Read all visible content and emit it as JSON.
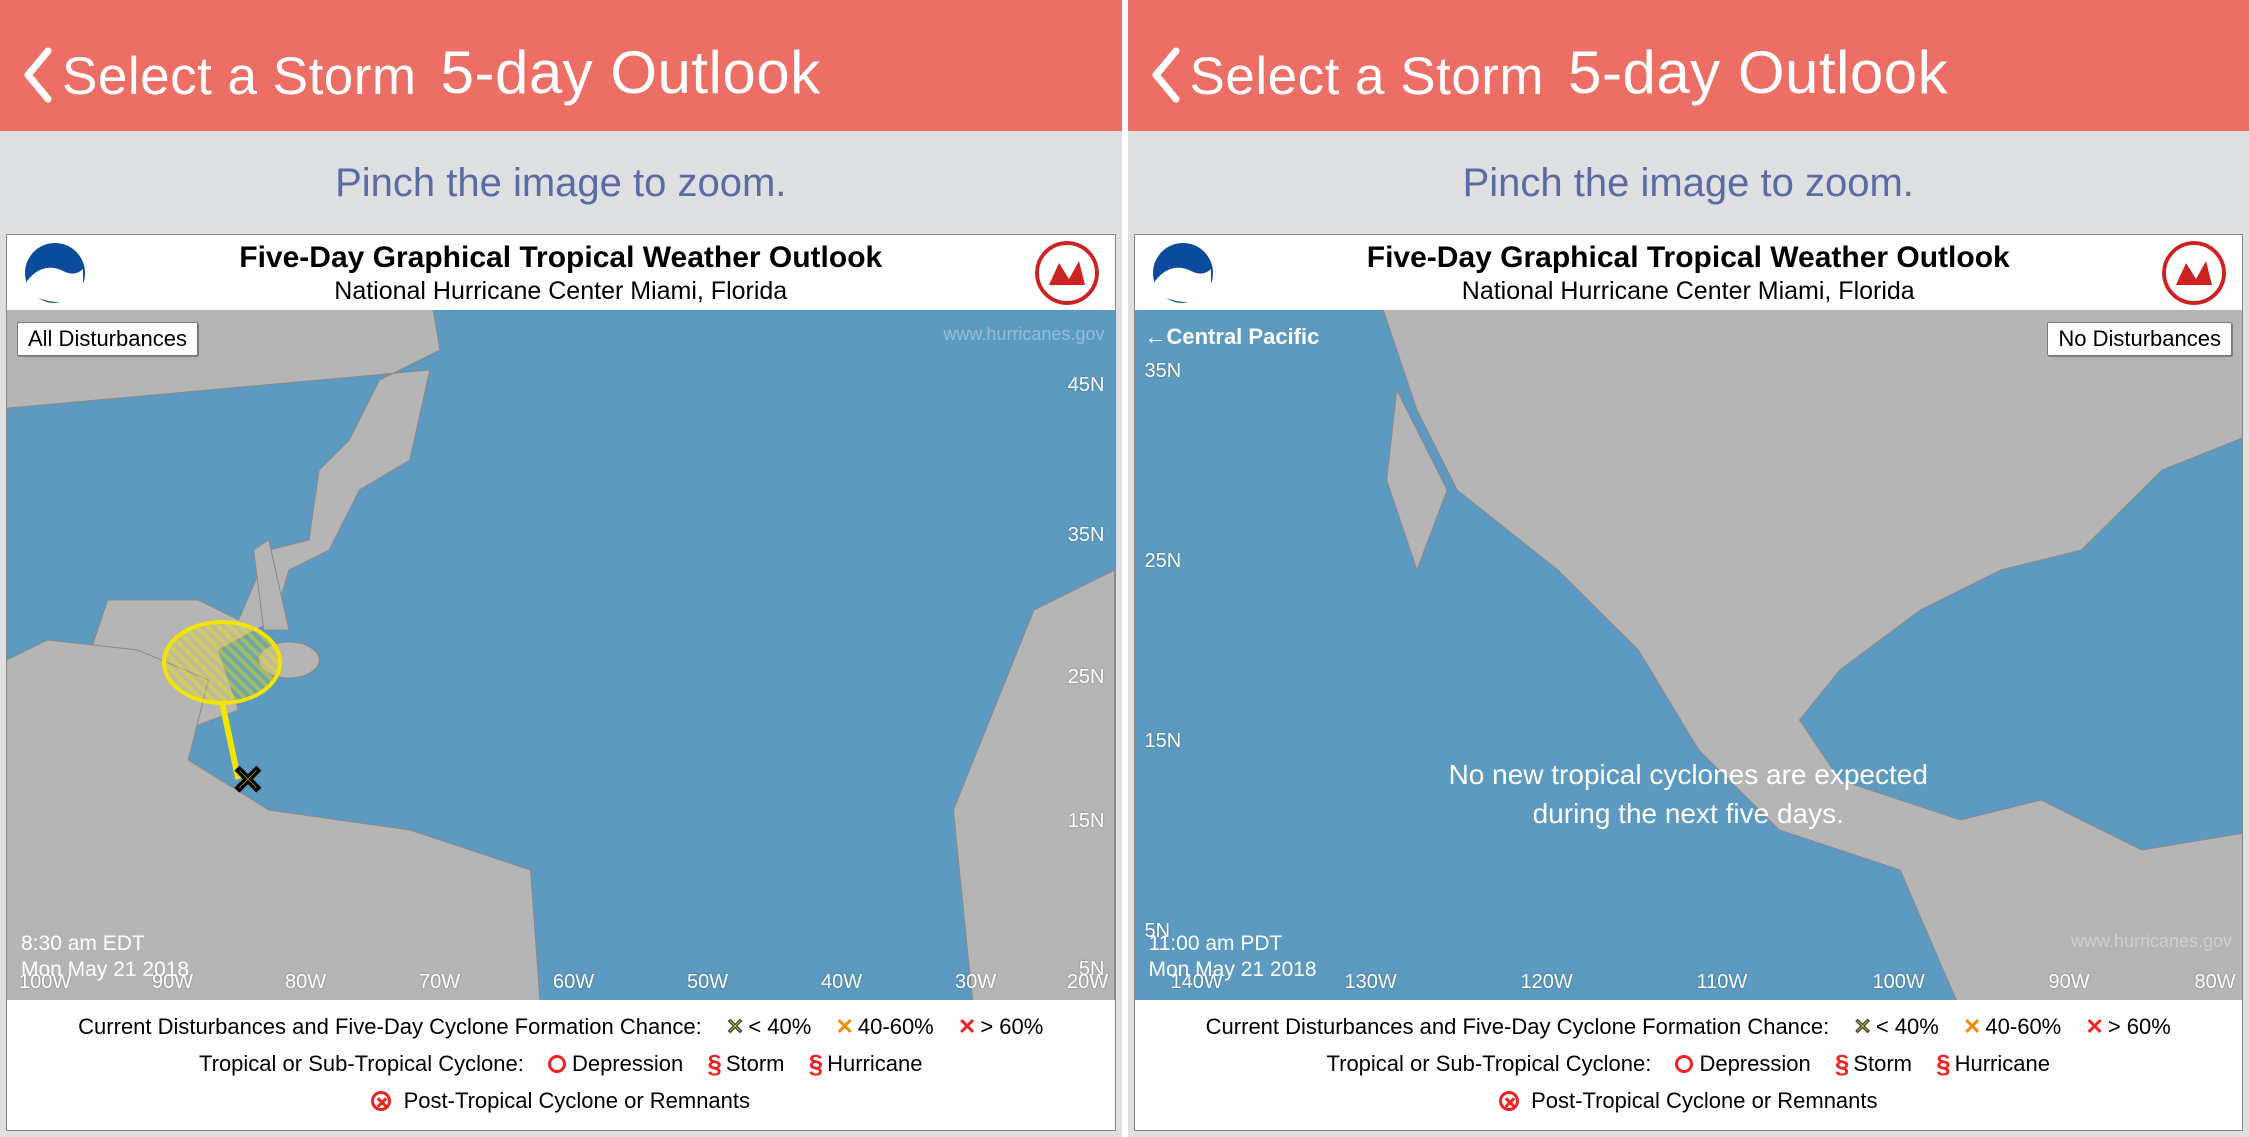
{
  "common": {
    "back_label": "Select a Storm",
    "title": "5-day Outlook",
    "hint": "Pinch the image to zoom.",
    "map_title": "Five-Day Graphical Tropical Weather Outlook",
    "map_subtitle": "National Hurricane Center  Miami, Florida",
    "watermark": "www.hurricanes.gov",
    "legend_line1_label": "Current Disturbances and Five-Day Cyclone Formation Chance:",
    "legend_lt40": "< 40%",
    "legend_4060": "40-60%",
    "legend_gt60": "> 60%",
    "legend_line2_label": "Tropical or Sub-Tropical Cyclone:",
    "legend_depression": "Depression",
    "legend_storm": "Storm",
    "legend_hurricane": "Hurricane",
    "legend_line3": "Post-Tropical Cyclone or Remnants"
  },
  "left": {
    "pill": "All Disturbances",
    "timestamp_line1": "8:30 am EDT",
    "timestamp_line2": "Mon May 21 2018",
    "lats": [
      "45N",
      "35N",
      "25N",
      "15N",
      "5N"
    ],
    "lons": [
      "100W",
      "90W",
      "80W",
      "70W",
      "60W",
      "50W",
      "40W",
      "30W",
      "20W"
    ]
  },
  "right": {
    "cp_label": "←Central Pacific",
    "pill": "No Disturbances",
    "msg_line1": "No new tropical cyclones are expected",
    "msg_line2": "during the next five days.",
    "timestamp_line1": "11:00 am PDT",
    "timestamp_line2": "Mon May 21 2018",
    "lats": [
      "35N",
      "25N",
      "15N",
      "5N"
    ],
    "lons": [
      "140W",
      "130W",
      "120W",
      "110W",
      "100W",
      "90W",
      "80W"
    ]
  }
}
